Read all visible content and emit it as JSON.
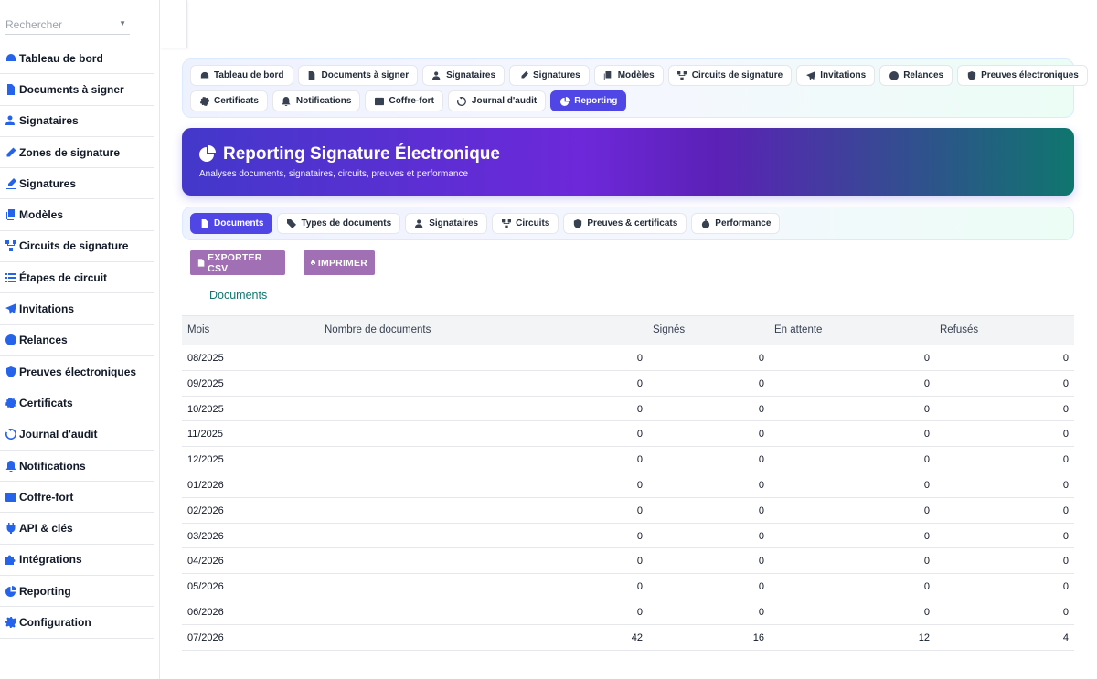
{
  "search": {
    "placeholder": "Rechercher"
  },
  "sidebar": {
    "items": [
      {
        "label": "Tableau de bord",
        "icon": "gauge-icon"
      },
      {
        "label": "Documents à signer",
        "icon": "file-icon"
      },
      {
        "label": "Signataires",
        "icon": "user-pen-icon"
      },
      {
        "label": "Zones de signature",
        "icon": "pen-icon"
      },
      {
        "label": "Signatures",
        "icon": "signature-icon"
      },
      {
        "label": "Modèles",
        "icon": "copy-icon"
      },
      {
        "label": "Circuits de signature",
        "icon": "diagram-icon"
      },
      {
        "label": "Étapes de circuit",
        "icon": "list-icon"
      },
      {
        "label": "Invitations",
        "icon": "paper-plane-icon"
      },
      {
        "label": "Relances",
        "icon": "clock-icon"
      },
      {
        "label": "Preuves électroniques",
        "icon": "shield-icon"
      },
      {
        "label": "Certificats",
        "icon": "certificate-icon"
      },
      {
        "label": "Journal d'audit",
        "icon": "history-icon"
      },
      {
        "label": "Notifications",
        "icon": "bell-icon"
      },
      {
        "label": "Coffre-fort",
        "icon": "vault-icon"
      },
      {
        "label": "API & clés",
        "icon": "plug-icon"
      },
      {
        "label": "Intégrations",
        "icon": "puzzle-icon"
      },
      {
        "label": "Reporting",
        "icon": "chart-pie-icon"
      },
      {
        "label": "Configuration",
        "icon": "gear-icon"
      }
    ]
  },
  "tabs": {
    "row1": [
      {
        "label": "Tableau de bord",
        "icon": "gauge-icon"
      },
      {
        "label": "Documents à signer",
        "icon": "file-icon"
      },
      {
        "label": "Signataires",
        "icon": "user-pen-icon"
      },
      {
        "label": "Signatures",
        "icon": "signature-icon"
      },
      {
        "label": "Modèles",
        "icon": "copy-icon"
      },
      {
        "label": "Circuits de signature",
        "icon": "diagram-icon"
      },
      {
        "label": "Invitations",
        "icon": "paper-plane-icon"
      },
      {
        "label": "Relances",
        "icon": "clock-icon"
      },
      {
        "label": "Preuves électroniques",
        "icon": "shield-icon"
      }
    ],
    "row2": [
      {
        "label": "Certificats",
        "icon": "certificate-icon"
      },
      {
        "label": "Notifications",
        "icon": "bell-icon"
      },
      {
        "label": "Coffre-fort",
        "icon": "vault-icon"
      },
      {
        "label": "Journal d'audit",
        "icon": "history-icon"
      },
      {
        "label": "Reporting",
        "icon": "chart-pie-icon",
        "active": true
      }
    ]
  },
  "banner": {
    "title": "Reporting Signature Électronique",
    "subtitle": "Analyses documents, signataires, circuits, preuves et performance"
  },
  "subtabs": [
    {
      "label": "Documents",
      "icon": "file-icon",
      "active": true
    },
    {
      "label": "Types de documents",
      "icon": "tags-icon"
    },
    {
      "label": "Signataires",
      "icon": "user-pen-icon"
    },
    {
      "label": "Circuits",
      "icon": "diagram-icon"
    },
    {
      "label": "Preuves & certificats",
      "icon": "shield-icon"
    },
    {
      "label": "Performance",
      "icon": "stopwatch-icon"
    }
  ],
  "actions": {
    "export": "EXPORTER CSV",
    "print": "IMPRIMER"
  },
  "section_title": "Documents",
  "table": {
    "headers": [
      "Mois",
      "Nombre de documents",
      "Signés",
      "En attente",
      "Refusés"
    ],
    "rows": [
      [
        "08/2025",
        "0",
        "0",
        "0",
        "0"
      ],
      [
        "09/2025",
        "0",
        "0",
        "0",
        "0"
      ],
      [
        "10/2025",
        "0",
        "0",
        "0",
        "0"
      ],
      [
        "11/2025",
        "0",
        "0",
        "0",
        "0"
      ],
      [
        "12/2025",
        "0",
        "0",
        "0",
        "0"
      ],
      [
        "01/2026",
        "0",
        "0",
        "0",
        "0"
      ],
      [
        "02/2026",
        "0",
        "0",
        "0",
        "0"
      ],
      [
        "03/2026",
        "0",
        "0",
        "0",
        "0"
      ],
      [
        "04/2026",
        "0",
        "0",
        "0",
        "0"
      ],
      [
        "05/2026",
        "0",
        "0",
        "0",
        "0"
      ],
      [
        "06/2026",
        "0",
        "0",
        "0",
        "0"
      ],
      [
        "07/2026",
        "42",
        "16",
        "12",
        "4"
      ]
    ]
  },
  "colors": {
    "accent": "#4f46e5",
    "sidebar_icon": "#2563eb",
    "button": "#a16fb3",
    "section_title": "#0f766e"
  }
}
